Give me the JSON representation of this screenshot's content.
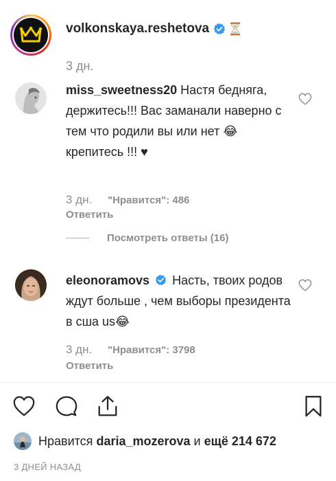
{
  "post": {
    "username": "volkonskaya.reshetova",
    "time": "3 дн.",
    "verified": true,
    "status_emoji": "hourglass"
  },
  "comments": [
    {
      "username": "miss_sweetness20",
      "text": "Настя бедняга, держитесь!!! Вас заманали наверно с тем что родили вы или нет 😂 крепитесь !!! ♥",
      "time": "3 дн.",
      "likes": "\"Нравится\": 486",
      "reply": "Ответить",
      "view_replies": "Посмотреть ответы (16)"
    },
    {
      "username": "eleonoramovs",
      "verified": true,
      "text": "Насть, твоих родов ждут больше , чем выборы президента в сша us😂",
      "time": "3 дн.",
      "likes": "\"Нравится\": 3798",
      "reply": "Ответить"
    }
  ],
  "likes_line": {
    "prefix": "Нравится",
    "user": "daria_mozerova",
    "conjunction": "и",
    "others": "ещё 214 672"
  },
  "date": "3 ДНЕЙ НАЗАД",
  "icons": [
    "heart-icon",
    "comment-icon",
    "share-icon",
    "bookmark-icon"
  ],
  "colors": {
    "verified": "#3897f0",
    "muted": "#8e8e8e",
    "text": "#262626"
  }
}
